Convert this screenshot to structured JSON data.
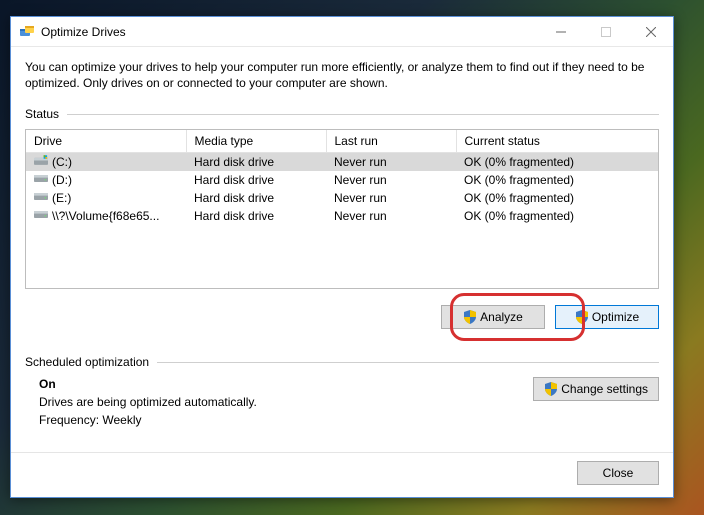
{
  "window": {
    "title": "Optimize Drives"
  },
  "intro": "You can optimize your drives to help your computer run more efficiently, or analyze them to find out if they need to be optimized. Only drives on or connected to your computer are shown.",
  "status_label": "Status",
  "table": {
    "headers": {
      "drive": "Drive",
      "media": "Media type",
      "last": "Last run",
      "status": "Current status"
    },
    "rows": [
      {
        "drive": "(C:)",
        "media": "Hard disk drive",
        "last": "Never run",
        "status": "OK (0% fragmented)",
        "icon": "os-drive",
        "selected": true
      },
      {
        "drive": "(D:)",
        "media": "Hard disk drive",
        "last": "Never run",
        "status": "OK (0% fragmented)",
        "icon": "drive",
        "selected": false
      },
      {
        "drive": "(E:)",
        "media": "Hard disk drive",
        "last": "Never run",
        "status": "OK (0% fragmented)",
        "icon": "drive",
        "selected": false
      },
      {
        "drive": "\\\\?\\Volume{f68e65...",
        "media": "Hard disk drive",
        "last": "Never run",
        "status": "OK (0% fragmented)",
        "icon": "drive",
        "selected": false
      }
    ]
  },
  "buttons": {
    "analyze": "Analyze",
    "optimize": "Optimize",
    "change": "Change settings",
    "close": "Close"
  },
  "sched": {
    "label": "Scheduled optimization",
    "on": "On",
    "line1": "Drives are being optimized automatically.",
    "freq": "Frequency: Weekly"
  },
  "annotation": {
    "present": true,
    "target": "optimize-button"
  }
}
